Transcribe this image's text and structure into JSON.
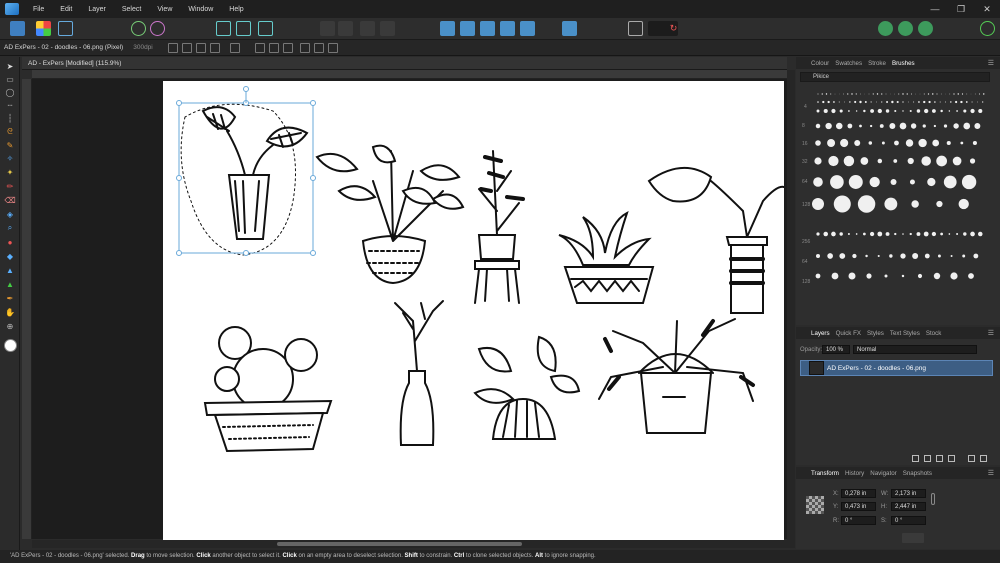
{
  "menu": [
    "File",
    "Edit",
    "Layer",
    "Select",
    "View",
    "Window",
    "Help"
  ],
  "window_controls": [
    "—",
    "❐",
    "✕"
  ],
  "context": {
    "doc_name": "AD ExPers - 02 - doodles - 06.png (Pixel)",
    "dpi": "300dpi"
  },
  "doc_tab": "AD - ExPers [Modified] (115.9%)",
  "brushes_panel": {
    "tabs": [
      "Colour",
      "Swatches",
      "Stroke",
      "Brushes"
    ],
    "active_tab": "Brushes",
    "category": "Pikice",
    "size_labels": [
      "4",
      "8",
      "16",
      "32",
      "64",
      "128",
      "256",
      "64",
      "128"
    ]
  },
  "layers_panel": {
    "tabs": [
      "Layers",
      "Quick FX",
      "Styles",
      "Text Styles",
      "Stock"
    ],
    "opacity_label": "Opacity:",
    "opacity_value": "100 %",
    "blend_mode": "Normal",
    "layer_name": "AD ExPers - 02 - doodles - 06.png"
  },
  "transform_panel": {
    "tabs": [
      "Transform",
      "History",
      "Navigator",
      "Snapshots"
    ],
    "x_label": "X:",
    "x_value": "0,278 in",
    "y_label": "Y:",
    "y_value": "0,473 in",
    "w_label": "W:",
    "w_value": "2,173 in",
    "h_label": "H:",
    "h_value": "2,447 in",
    "r_label": "R:",
    "r_value": "0 °",
    "s_label": "S:",
    "s_value": "0 °"
  },
  "status": {
    "p1": "'AD ExPers - 02 - doodles - 06.png' selected. ",
    "k1": "Drag",
    "p2": " to move selection. ",
    "k2": "Click",
    "p3": " another object to select it. ",
    "k3": "Click",
    "p4": " on an empty area to deselect selection. ",
    "k4": "Shift",
    "p5": " to constrain. ",
    "k5": "Ctrl",
    "p6": " to clone selected objects. ",
    "k6": "Alt",
    "p7": " to ignore snapping."
  },
  "icons": [
    "affinity-logo-icon",
    "move-tool-icon",
    "brush-tool-icon",
    "eraser-tool-icon",
    "fill-tool-icon",
    "zoom-tool-icon",
    "color-swatch-icon",
    "user-icon"
  ]
}
